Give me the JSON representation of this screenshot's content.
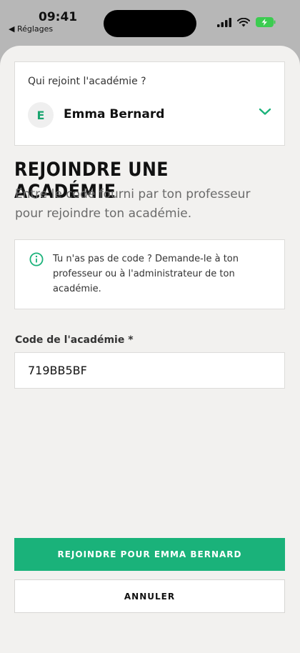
{
  "status_bar": {
    "time": "09:41",
    "back_app": "◀ Réglages",
    "icons": [
      "signal-icon",
      "wifi-icon",
      "battery-charging-icon"
    ]
  },
  "member_select": {
    "label": "Qui rejoint l'académie ?",
    "avatar_initial": "E",
    "selected_name": "Emma Bernard",
    "chevron_icon": "chevron-down-icon"
  },
  "page": {
    "title": "REJOINDRE UNE ACADÉMIE",
    "subtitle": "Entre le code fourni par ton professeur pour rejoindre ton académie."
  },
  "info": {
    "icon": "info-icon",
    "text": "Tu n'as pas de code ? Demande-le à ton professeur ou à l'administrateur de ton académie."
  },
  "form": {
    "code_label": "Code de l'académie *",
    "code_value": "719BB5BF"
  },
  "actions": {
    "join_label": "REJOINDRE POUR EMMA BERNARD",
    "cancel_label": "ANNULER"
  },
  "colors": {
    "accent": "#1ab27a",
    "background": "#f2f1ef"
  }
}
